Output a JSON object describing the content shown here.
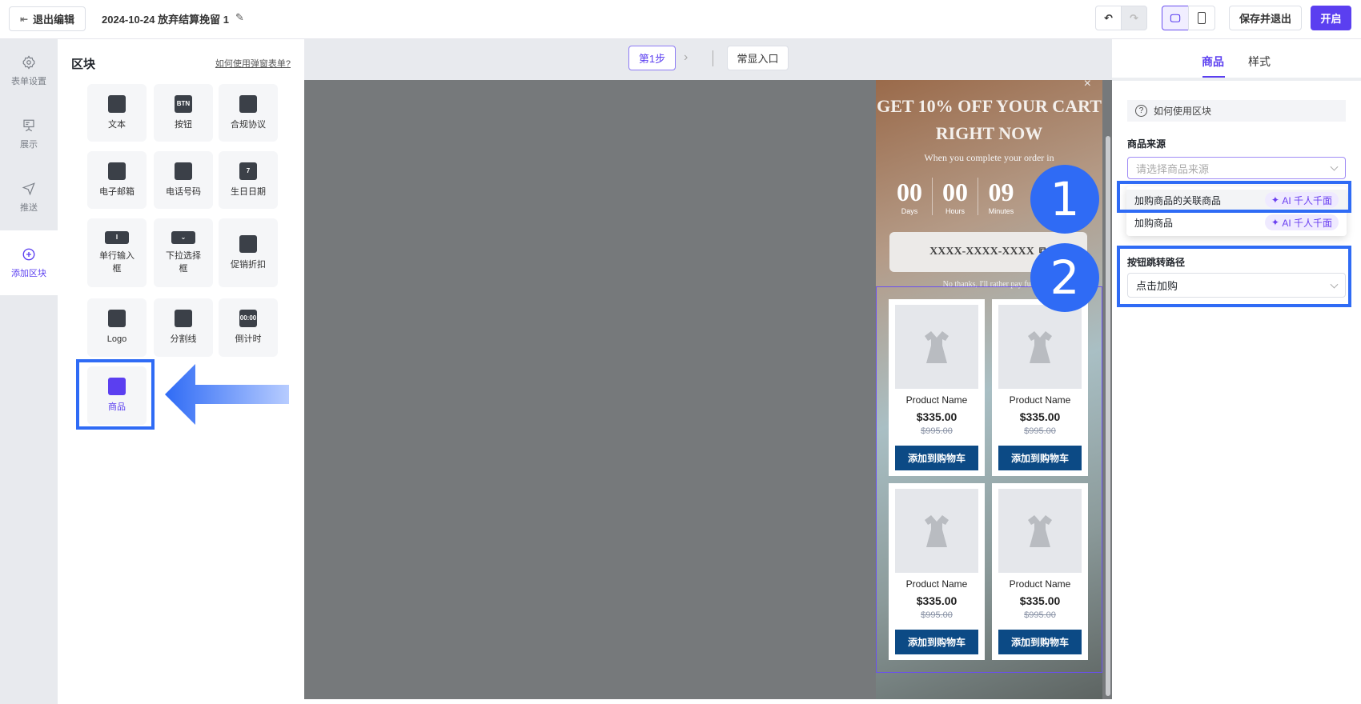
{
  "topbar": {
    "exit_label": "退出编辑",
    "title": "2024-10-24 放弃结算挽留 1",
    "save_exit_label": "保存并退出",
    "enable_label": "开启"
  },
  "rail": {
    "items": [
      {
        "label": "表单设置",
        "icon": "gear-icon"
      },
      {
        "label": "展示",
        "icon": "display-icon"
      },
      {
        "label": "推送",
        "icon": "send-icon"
      },
      {
        "label": "添加区块",
        "icon": "plus-circle-icon",
        "active": true
      }
    ]
  },
  "blocks": {
    "title": "区块",
    "help_link": "如何使用弹窗表单?",
    "items": [
      {
        "label": "文本",
        "icon": "text-icon"
      },
      {
        "label": "按钮",
        "icon": "btn-icon",
        "glyph": "BTN"
      },
      {
        "label": "合规协议",
        "icon": "shield-check-icon"
      },
      {
        "label": "电子邮箱",
        "icon": "mail-icon"
      },
      {
        "label": "电话号码",
        "icon": "phone-icon"
      },
      {
        "label": "生日日期",
        "icon": "calendar-icon",
        "glyph": "7"
      },
      {
        "label": "单行输入框",
        "icon": "input-icon",
        "glyph": "I"
      },
      {
        "label": "下拉选择框",
        "icon": "dropdown-icon",
        "glyph": "⌄"
      },
      {
        "label": "促销折扣",
        "icon": "tag-icon"
      },
      {
        "label": "Logo",
        "icon": "image-icon"
      },
      {
        "label": "分割线",
        "icon": "divider-icon"
      },
      {
        "label": "倒计时",
        "icon": "countdown-icon",
        "glyph": "00:00"
      },
      {
        "label": "商品",
        "icon": "shopping-bag-icon",
        "highlighted": true
      }
    ]
  },
  "canvas": {
    "step_label": "第1步",
    "entry_label": "常显入口"
  },
  "popup": {
    "headline": "GET 10% OFF YOUR CART RIGHT NOW",
    "subtitle": "When you complete your order in",
    "countdown": [
      {
        "value": "00",
        "unit": "Days"
      },
      {
        "value": "00",
        "unit": "Hours"
      },
      {
        "value": "09",
        "unit": "Minutes"
      }
    ],
    "code": "XXXX-XXXX-XXXX",
    "decline": "No thanks, I'll rather pay full",
    "products": [
      {
        "name": "Product Name",
        "price": "$335.00",
        "old_price": "$995.00",
        "button": "添加到购物车"
      },
      {
        "name": "Product Name",
        "price": "$335.00",
        "old_price": "$995.00",
        "button": "添加到购物车"
      },
      {
        "name": "Product Name",
        "price": "$335.00",
        "old_price": "$995.00",
        "button": "添加到购物车"
      },
      {
        "name": "Product Name",
        "price": "$335.00",
        "old_price": "$995.00",
        "button": "添加到购物车"
      }
    ]
  },
  "annotations": {
    "one": "1",
    "two": "2"
  },
  "right": {
    "tabs": [
      {
        "label": "商品",
        "active": true
      },
      {
        "label": "样式"
      }
    ],
    "help": "如何使用区块",
    "source_label": "商品来源",
    "source_placeholder": "请选择商品来源",
    "options": [
      {
        "label": "加购商品的关联商品",
        "badge": "AI 千人千面"
      },
      {
        "label": "加购商品",
        "badge": "AI 千人千面"
      }
    ],
    "path_label": "按钮跳转路径",
    "path_value": "点击加购"
  },
  "colors": {
    "accent": "#5b3ff0",
    "annotation": "#2f6bf5",
    "cart_button": "#0c4a85"
  }
}
